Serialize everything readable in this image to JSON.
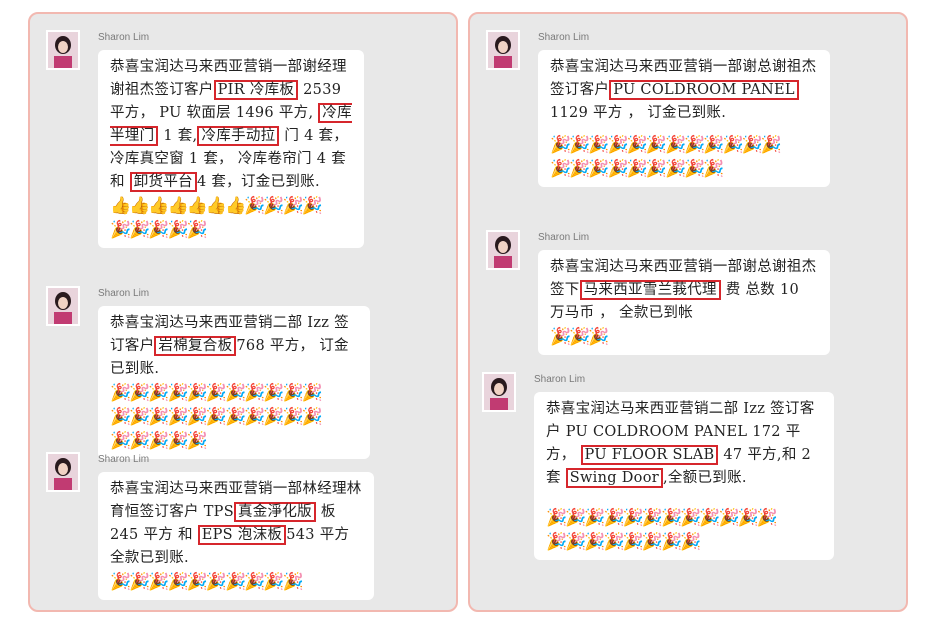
{
  "emoji": {
    "thumb": "👍",
    "party": "🎉"
  },
  "left_panel": {
    "messages": [
      {
        "sender": "Sharon Lim",
        "t1": "恭喜宝润达马来西亚营销一部谢经理谢祖杰签订客户",
        "h1": "PIR 冷库板",
        "t2": "2539 平方， PU 软面层 1496 平方,",
        "h2": "冷库半埋门",
        "t3": " 1 套,",
        "h3": "冷库手动拉",
        "t4": "门 4 套， 冷库真空窗 1 套， 冷库卷帘门 4 套 和",
        "h4": "卸货平台",
        "t5": "4 套，订金已到账.",
        "thumbs": 7,
        "parties": 9
      },
      {
        "sender": "Sharon Lim",
        "t1": "恭喜宝润达马来西亚营销二部 Izz 签订客户",
        "h1": "岩棉复合板",
        "t2": "768 平方， 订金已到账.",
        "parties": 27
      },
      {
        "sender": "Sharon Lim",
        "t1": "恭喜宝润达马来西亚营销一部林经理林育恒签订客户 TPS",
        "h1": "真金淨化版",
        "t2": "板 245 平方 和",
        "h2": "EPS 泡沫板",
        "t3": "543 平方 全款已到账.",
        "parties": 10
      }
    ]
  },
  "right_panel": {
    "messages": [
      {
        "sender": "Sharon Lim",
        "t1": "恭喜宝润达马来西亚营销一部谢总谢祖杰签订客户",
        "h1": "PU COLDROOM PANEL",
        "t2": "1129 平方 ， 订金已到账.",
        "parties": 21
      },
      {
        "sender": "Sharon Lim",
        "t1": "恭喜宝润达马来西亚营销一部谢总谢祖杰签下",
        "h1": "马来西亚雪兰莪代理",
        "t2": "费 总数 10 万马币 ， 全款已到帐",
        "parties": 3
      },
      {
        "sender": "Sharon Lim",
        "t1": "恭喜宝润达马来西亚营销二部 Izz 签订客户 PU COLDROOM PANEL 172 平方，",
        "h1": "PU FLOOR SLAB",
        "t2": "47 平方,和 2 套",
        "h2": "Swing Door",
        "t3": ",全额已到账.",
        "parties": 20
      }
    ]
  }
}
